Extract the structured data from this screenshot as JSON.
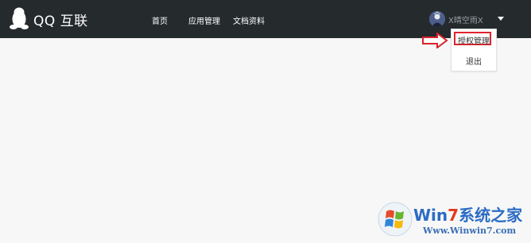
{
  "header": {
    "logo_text": "QQ 互联",
    "nav": [
      {
        "label": "首页"
      },
      {
        "label": "应用管理"
      },
      {
        "label": "文档资料"
      }
    ],
    "user": {
      "name": "X晴空雨X"
    }
  },
  "dropdown": {
    "items": [
      {
        "label": "授权管理"
      },
      {
        "label": "退出"
      }
    ]
  },
  "watermark": {
    "brand_prefix": "Win",
    "brand_number": "7",
    "brand_suffix": "系统之家",
    "url": "Www.Winwin7.com"
  },
  "colors": {
    "topbar": "#252a2d",
    "page_bg": "#f7f7f7",
    "highlight_red": "#e0232d"
  },
  "icons": [
    "qq-penguin-icon",
    "avatar",
    "caret-down-icon",
    "arrow-right-icon",
    "windows-logo-icon"
  ]
}
